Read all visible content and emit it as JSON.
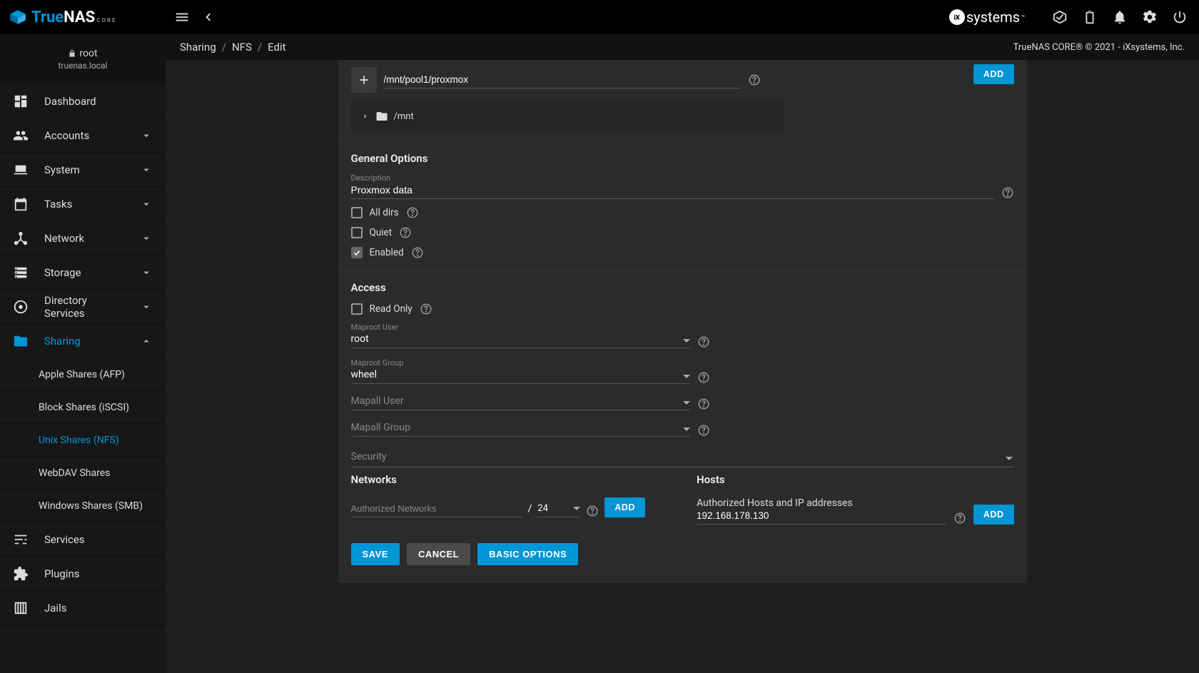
{
  "logo": {
    "brand_true": "True",
    "brand_nas": "NAS",
    "sub": "CORE"
  },
  "topbar": {
    "ix": "systems"
  },
  "user": {
    "name": "root",
    "host": "truenas.local"
  },
  "nav": {
    "dashboard": "Dashboard",
    "accounts": "Accounts",
    "system": "System",
    "tasks": "Tasks",
    "network": "Network",
    "storage": "Storage",
    "directory_services": "Directory Services",
    "sharing": "Sharing",
    "sharing_sub": {
      "afp": "Apple Shares (AFP)",
      "iscsi": "Block Shares (iSCSI)",
      "nfs": "Unix Shares (NFS)",
      "webdav": "WebDAV Shares",
      "smb": "Windows Shares (SMB)"
    },
    "services": "Services",
    "plugins": "Plugins",
    "jails": "Jails"
  },
  "breadcrumb": {
    "a": "Sharing",
    "b": "NFS",
    "c": "Edit"
  },
  "copyright": "TrueNAS CORE® © 2021 - iXsystems, Inc.",
  "form": {
    "path_value": "/mnt/pool1/proxmox",
    "tree_root": "/mnt",
    "add": "ADD",
    "general_title": "General Options",
    "desc_label": "Description",
    "desc_value": "Proxmox data",
    "alldirs": "All dirs",
    "quiet": "Quiet",
    "enabled": "Enabled",
    "access_title": "Access",
    "readonly": "Read Only",
    "maproot_user_label": "Maproot User",
    "maproot_user_value": "root",
    "maproot_group_label": "Maproot Group",
    "maproot_group_value": "wheel",
    "mapall_user_label": "Mapall User",
    "mapall_group_label": "Mapall Group",
    "security": "Security",
    "networks_title": "Networks",
    "auth_net_label": "Authorized Networks",
    "mask": "24",
    "hosts_title": "Hosts",
    "hosts_label": "Authorized Hosts and IP addresses",
    "hosts_value": "192.168.178.130",
    "save": "SAVE",
    "cancel": "CANCEL",
    "basic": "BASIC OPTIONS"
  }
}
